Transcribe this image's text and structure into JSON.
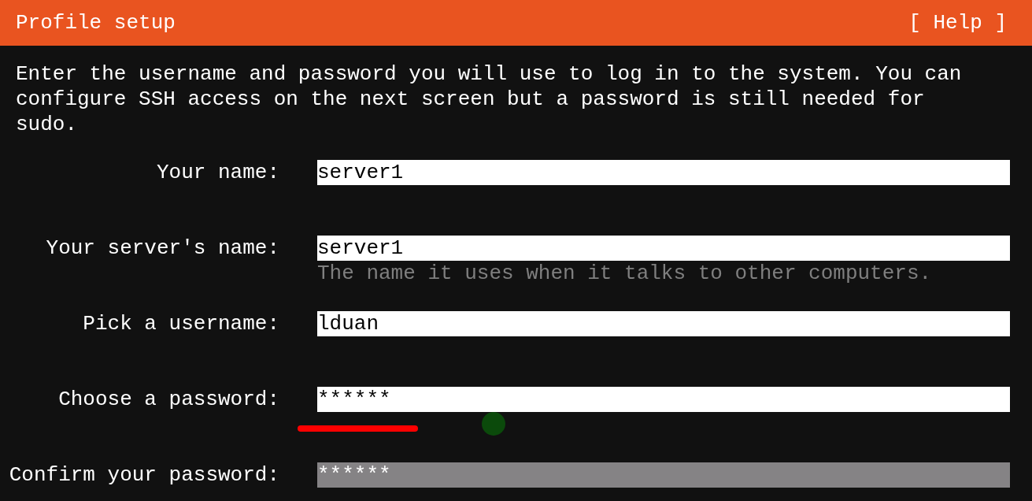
{
  "header": {
    "title": "Profile setup",
    "help": "[ Help ]"
  },
  "intro": "Enter the username and password you will use to log in to the system. You can configure SSH access on the next screen but a password is still needed for sudo.",
  "fields": [
    {
      "label": "Your name:",
      "value": "server1",
      "focused": false
    },
    {
      "label": "Your server's name:",
      "value": "server1",
      "hint": "The name it uses when it talks to other computers.",
      "focused": false
    },
    {
      "label": "Pick a username:",
      "value": "lduan",
      "focused": false
    },
    {
      "label": "Choose a password:",
      "value": "******",
      "focused": false
    },
    {
      "label": "Confirm your password:",
      "value": "******",
      "focused": true
    }
  ]
}
